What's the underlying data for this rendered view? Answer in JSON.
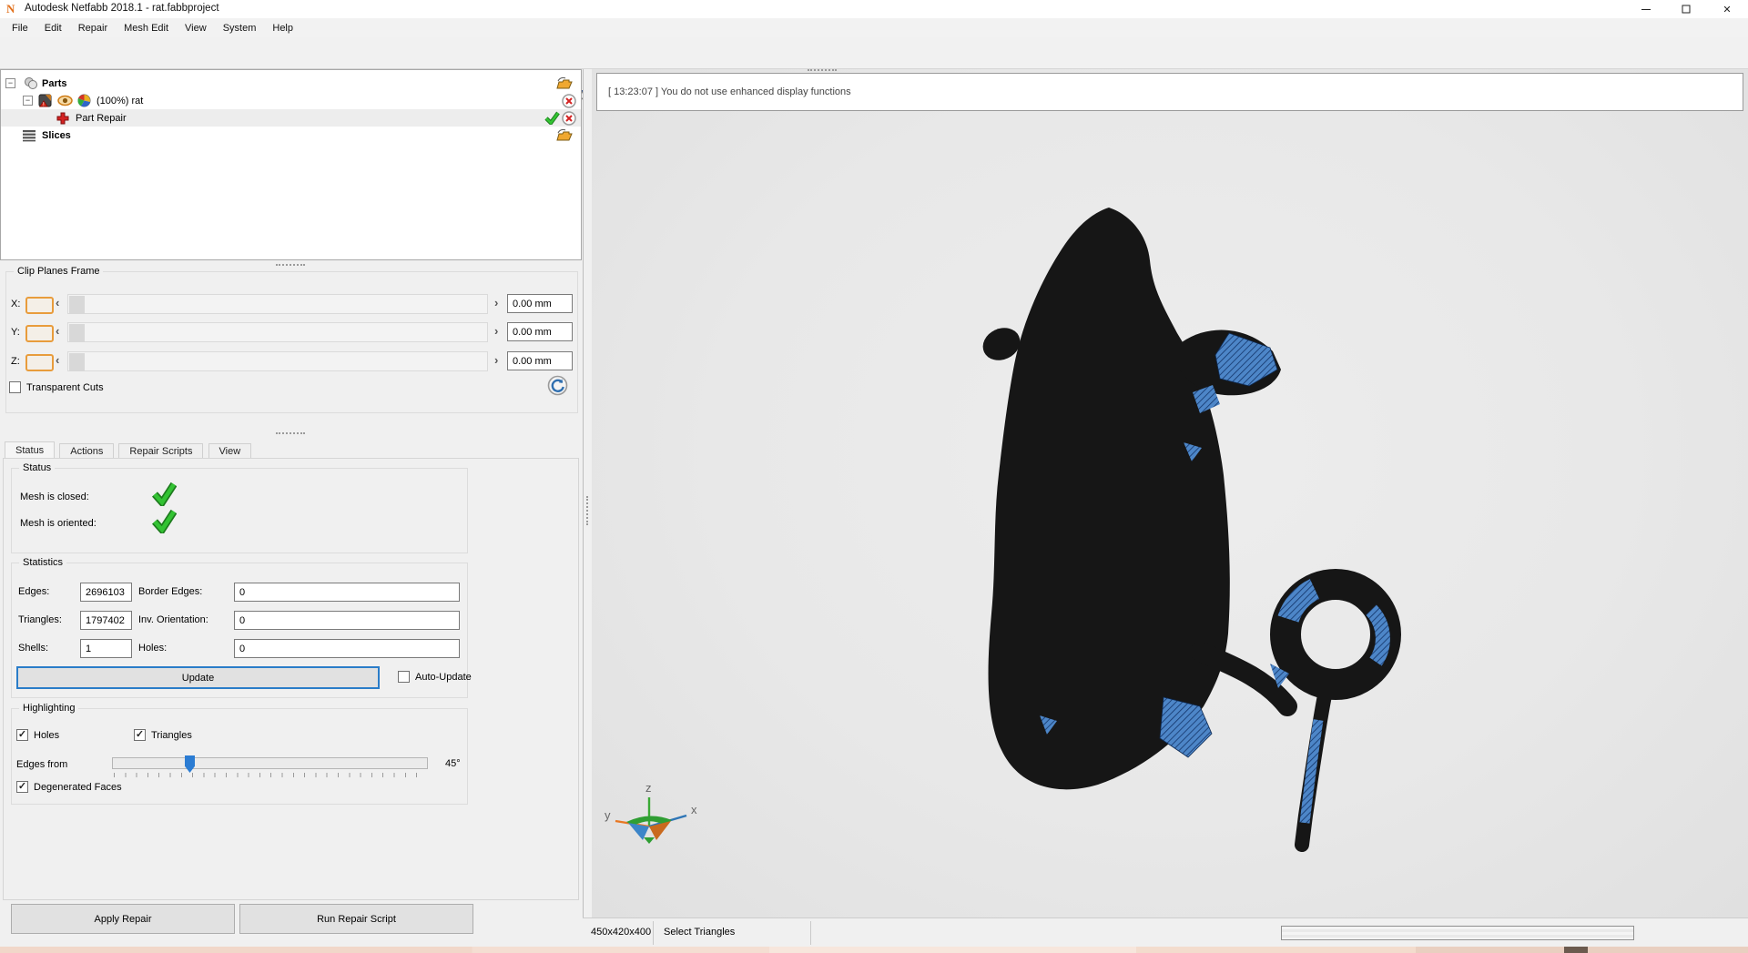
{
  "window": {
    "title": "Autodesk Netfabb 2018.1 - rat.fabbproject",
    "controls": [
      "minimize",
      "maximize",
      "close"
    ]
  },
  "menu": {
    "items": [
      "File",
      "Edit",
      "Repair",
      "Mesh Edit",
      "View",
      "System",
      "Help"
    ]
  },
  "toolbar": {
    "icons": [
      "open-project",
      "add-parts",
      "part-info",
      "new-repair",
      "view-cube-cut",
      "view-cube-wire",
      "view-cube-bottom",
      "view-cube-left",
      "view-cube-right",
      "view-cube-front",
      "view-cube-shaded",
      "sphere-view",
      "fit-view",
      "zoom",
      "select-triangle",
      "select-surface",
      "select-shell",
      "add-selection",
      "add-selection-visible",
      "remove-selection",
      "invert-selection",
      "select-all-green",
      "select-all-blue",
      "select-visible",
      "repair-part",
      "render-mode"
    ]
  },
  "tree": {
    "parts_label": "Parts",
    "rat_label": "(100%) rat",
    "repair_label": "Part Repair",
    "slices_label": "Slices"
  },
  "clip_planes": {
    "title": "Clip Planes Frame",
    "axes": [
      {
        "label": "X:",
        "value": "0.00 mm"
      },
      {
        "label": "Y:",
        "value": "0.00 mm"
      },
      {
        "label": "Z:",
        "value": "0.00 mm"
      }
    ],
    "transparent_cuts_label": "Transparent Cuts"
  },
  "tabs": {
    "items": [
      "Status",
      "Actions",
      "Repair Scripts",
      "View"
    ],
    "active": "Status"
  },
  "status_group": {
    "title": "Status",
    "mesh_closed_label": "Mesh is closed:",
    "mesh_oriented_label": "Mesh is oriented:"
  },
  "statistics": {
    "title": "Statistics",
    "edges_label": "Edges:",
    "edges_value": "2696103",
    "border_edges_label": "Border Edges:",
    "border_edges_value": "0",
    "triangles_label": "Triangles:",
    "triangles_value": "1797402",
    "inv_orientation_label": "Inv. Orientation:",
    "inv_orientation_value": "0",
    "shells_label": "Shells:",
    "shells_value": "1",
    "holes_label": "Holes:",
    "holes_value": "0",
    "update_label": "Update",
    "auto_update_label": "Auto-Update"
  },
  "highlighting": {
    "title": "Highlighting",
    "holes_label": "Holes",
    "triangles_label": "Triangles",
    "edges_from_label": "Edges from",
    "angle_value": "45°",
    "degenerated_label": "Degenerated Faces",
    "slider_percent": 24
  },
  "actions": {
    "apply_label": "Apply Repair",
    "run_label": "Run Repair Script"
  },
  "viewport": {
    "message": "[ 13:23:07 ] You do not use enhanced display functions",
    "axes": {
      "x": "x",
      "y": "y",
      "z": "z"
    }
  },
  "statusbar": {
    "dimensions": "450x420x400",
    "mode": "Select Triangles"
  },
  "colors": {
    "accent_blue": "#2a7dc9",
    "check_green": "#2eb22e",
    "selection_blue_bg": "#cde5f7",
    "hatch_blue": "#4d86c8",
    "salmon_strip": "#f3dccd",
    "model_black": "#161616"
  }
}
